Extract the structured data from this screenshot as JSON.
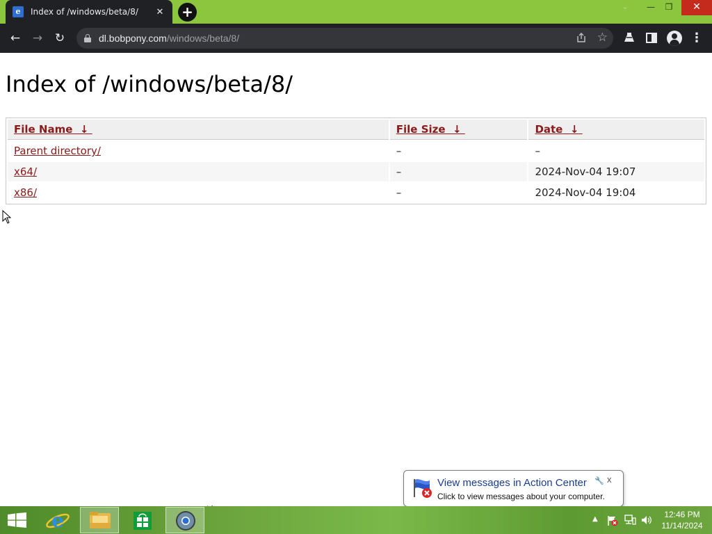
{
  "browser": {
    "tab": {
      "title": "Index of /windows/beta/8/",
      "close": "✕"
    },
    "new_tab": "+",
    "window_controls": {
      "tab_search": "⌄",
      "minimize": "—",
      "restore": "❐",
      "close": "✕"
    },
    "toolbar": {
      "back": "←",
      "forward": "→",
      "reload": "↻",
      "url_host": "dl.bobpony.com",
      "url_path": "/windows/beta/8/",
      "menu": "⋮"
    },
    "accent_color": "#8cc63f",
    "chrome_bg": "#202124"
  },
  "page": {
    "title": "Index of /windows/beta/8/",
    "columns": [
      {
        "label": "File Name",
        "sort": "↓"
      },
      {
        "label": "File Size",
        "sort": "↓"
      },
      {
        "label": "Date",
        "sort": "↓"
      }
    ],
    "rows": [
      {
        "name": "Parent directory/",
        "size": "–",
        "date": "–"
      },
      {
        "name": "x64/",
        "size": "–",
        "date": "2024-Nov-04 19:07"
      },
      {
        "name": "x86/",
        "size": "–",
        "date": "2024-Nov-04 19:04"
      }
    ],
    "link_color": "#8b1a1a"
  },
  "notification": {
    "title": "View messages in Action Center",
    "text": "Click to view messages about your computer.",
    "close": "x",
    "settings": "🔧"
  },
  "taskbar": {
    "apps": [
      {
        "name": "Internet Explorer",
        "icon": "ie-icon"
      },
      {
        "name": "File Explorer",
        "icon": "folder-icon"
      },
      {
        "name": "Store",
        "icon": "store-icon"
      },
      {
        "name": "Chrome",
        "icon": "chrome-icon"
      }
    ],
    "tray_chevron": "▲",
    "time": "12:46 PM",
    "date": "11/14/2024"
  }
}
